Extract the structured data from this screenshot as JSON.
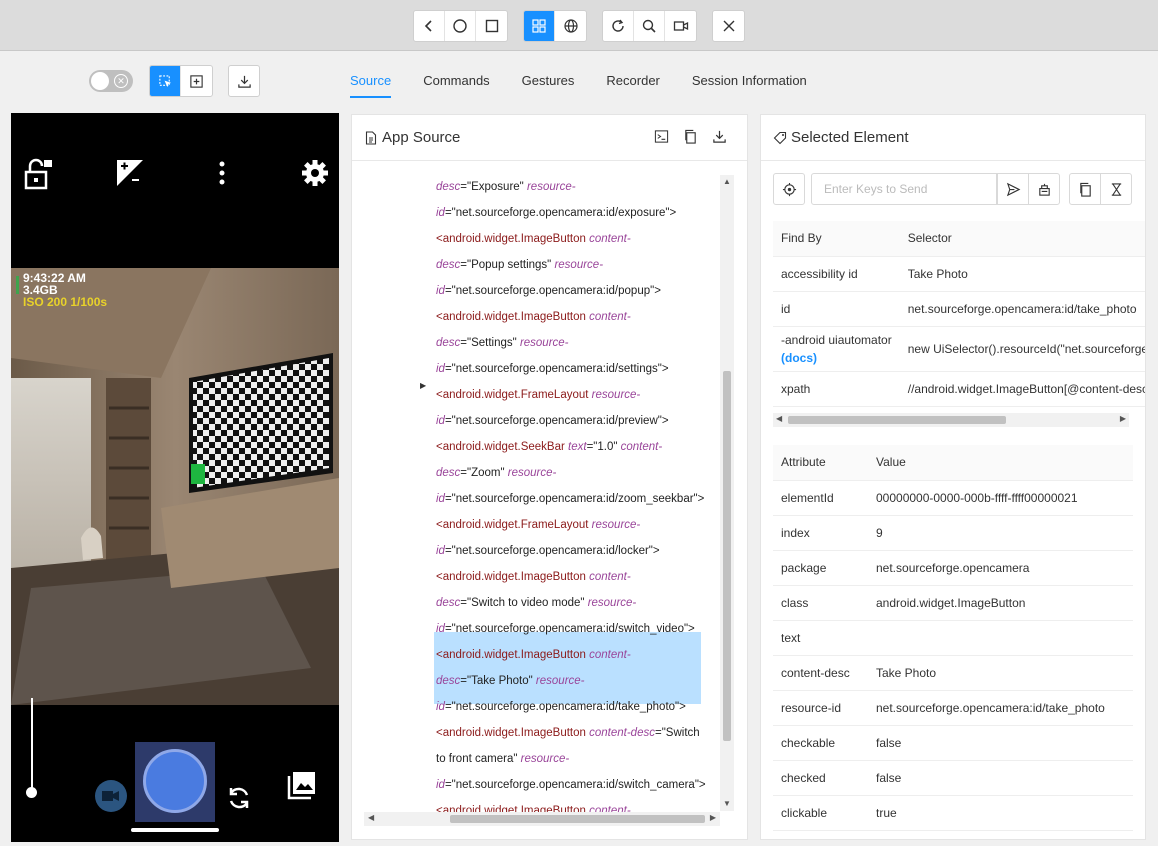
{
  "tabs": [
    "Source",
    "Commands",
    "Gestures",
    "Recorder",
    "Session Information"
  ],
  "device": {
    "time": "9:43:22 AM",
    "storage": "3.4GB",
    "iso": "ISO 200  1/100s"
  },
  "source_panel": {
    "title": "App Source",
    "lines": [
      [
        {
          "t": "attr",
          "v": "desc"
        },
        {
          "t": "val",
          "v": "=\"Exposure\" "
        },
        {
          "t": "attr",
          "v": "resource-"
        }
      ],
      [
        {
          "t": "attr",
          "v": "id"
        },
        {
          "t": "val",
          "v": "=\"net.sourceforge.opencamera:id/exposure\">"
        }
      ],
      [
        {
          "t": "tag",
          "v": "<android.widget.ImageButton "
        },
        {
          "t": "attr",
          "v": "content-"
        }
      ],
      [
        {
          "t": "attr",
          "v": "desc"
        },
        {
          "t": "val",
          "v": "=\"Popup settings\" "
        },
        {
          "t": "attr",
          "v": "resource-"
        }
      ],
      [
        {
          "t": "attr",
          "v": "id"
        },
        {
          "t": "val",
          "v": "=\"net.sourceforge.opencamera:id/popup\">"
        }
      ],
      [
        {
          "t": "tag",
          "v": "<android.widget.ImageButton "
        },
        {
          "t": "attr",
          "v": "content-"
        }
      ],
      [
        {
          "t": "attr",
          "v": "desc"
        },
        {
          "t": "val",
          "v": "=\"Settings\" "
        },
        {
          "t": "attr",
          "v": "resource-"
        }
      ],
      [
        {
          "t": "attr",
          "v": "id"
        },
        {
          "t": "val",
          "v": "=\"net.sourceforge.opencamera:id/settings\">"
        }
      ],
      [
        {
          "t": "tag",
          "v": "<android.widget.FrameLayout "
        },
        {
          "t": "attr",
          "v": "resource-"
        }
      ],
      [
        {
          "t": "attr",
          "v": "id"
        },
        {
          "t": "val",
          "v": "=\"net.sourceforge.opencamera:id/preview\">"
        }
      ],
      [
        {
          "t": "tag",
          "v": "<android.widget.SeekBar "
        },
        {
          "t": "attr",
          "v": "text"
        },
        {
          "t": "val",
          "v": "=\"1.0\" "
        },
        {
          "t": "attr",
          "v": "content-"
        }
      ],
      [
        {
          "t": "attr",
          "v": "desc"
        },
        {
          "t": "val",
          "v": "=\"Zoom\" "
        },
        {
          "t": "attr",
          "v": "resource-"
        }
      ],
      [
        {
          "t": "attr",
          "v": "id"
        },
        {
          "t": "val",
          "v": "=\"net.sourceforge.opencamera:id/zoom_seekbar\">"
        }
      ],
      [
        {
          "t": "tag",
          "v": "<android.widget.FrameLayout "
        },
        {
          "t": "attr",
          "v": "resource-"
        }
      ],
      [
        {
          "t": "attr",
          "v": "id"
        },
        {
          "t": "val",
          "v": "=\"net.sourceforge.opencamera:id/locker\">"
        }
      ],
      [
        {
          "t": "tag",
          "v": "<android.widget.ImageButton "
        },
        {
          "t": "attr",
          "v": "content-"
        }
      ],
      [
        {
          "t": "attr",
          "v": "desc"
        },
        {
          "t": "val",
          "v": "=\"Switch to video mode\" "
        },
        {
          "t": "attr",
          "v": "resource-"
        }
      ],
      [
        {
          "t": "attr",
          "v": "id"
        },
        {
          "t": "val",
          "v": "=\"net.sourceforge.opencamera:id/switch_video\">"
        }
      ],
      [
        {
          "t": "tag",
          "v": "<android.widget.ImageButton "
        },
        {
          "t": "attr",
          "v": "content-"
        }
      ],
      [
        {
          "t": "attr",
          "v": "desc"
        },
        {
          "t": "val",
          "v": "=\"Take Photo\" "
        },
        {
          "t": "attr",
          "v": "resource-"
        }
      ],
      [
        {
          "t": "attr",
          "v": "id"
        },
        {
          "t": "val",
          "v": "=\"net.sourceforge.opencamera:id/take_photo\">"
        }
      ],
      [
        {
          "t": "tag",
          "v": "<android.widget.ImageButton "
        },
        {
          "t": "attr",
          "v": "content-desc"
        },
        {
          "t": "val",
          "v": "=\"Switch"
        }
      ],
      [
        {
          "t": "val",
          "v": "to front camera\" "
        },
        {
          "t": "attr",
          "v": "resource-"
        }
      ],
      [
        {
          "t": "attr",
          "v": "id"
        },
        {
          "t": "val",
          "v": "=\"net.sourceforge.opencamera:id/switch_camera\">"
        }
      ],
      [
        {
          "t": "tag",
          "v": "<android.widget.ImageButton "
        },
        {
          "t": "attr",
          "v": "content-"
        }
      ]
    ]
  },
  "selected_panel": {
    "title": "Selected Element",
    "keys_placeholder": "Enter Keys to Send",
    "find_by_headers": [
      "Find By",
      "Selector"
    ],
    "find_by_rows": [
      {
        "by": "accessibility id",
        "selector": "Take Photo"
      },
      {
        "by": "id",
        "selector": "net.sourceforge.opencamera:id/take_photo"
      },
      {
        "by": "-android uiautomator",
        "docs": "(docs)",
        "selector": "new UiSelector().resourceId(\"net.sourceforge.opencamera:id/take_photo\")"
      },
      {
        "by": "xpath",
        "selector": "//android.widget.ImageButton[@content-desc=\"Take Photo\"]"
      }
    ],
    "attr_headers": [
      "Attribute",
      "Value"
    ],
    "attributes": [
      {
        "name": "elementId",
        "value": "00000000-0000-000b-ffff-ffff00000021"
      },
      {
        "name": "index",
        "value": "9"
      },
      {
        "name": "package",
        "value": "net.sourceforge.opencamera"
      },
      {
        "name": "class",
        "value": "android.widget.ImageButton"
      },
      {
        "name": "text",
        "value": ""
      },
      {
        "name": "content-desc",
        "value": "Take Photo"
      },
      {
        "name": "resource-id",
        "value": "net.sourceforge.opencamera:id/take_photo"
      },
      {
        "name": "checkable",
        "value": "false"
      },
      {
        "name": "checked",
        "value": "false"
      },
      {
        "name": "clickable",
        "value": "true"
      }
    ]
  }
}
